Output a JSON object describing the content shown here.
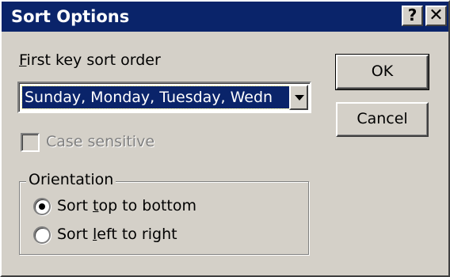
{
  "window": {
    "title": "Sort Options",
    "help_button": "?",
    "close_button": "✕"
  },
  "first_key": {
    "label_prefix": "",
    "label_accel": "F",
    "label_rest": "irst key sort order",
    "selected_value": "Sunday, Monday, Tuesday, Wedn"
  },
  "buttons": {
    "ok": "OK",
    "cancel": "Cancel"
  },
  "case_sensitive": {
    "label": "Case sensitive",
    "checked": false,
    "enabled": false
  },
  "orientation": {
    "legend": "Orientation",
    "options": [
      {
        "pre": "Sort ",
        "accel": "t",
        "post": "op to bottom",
        "checked": true
      },
      {
        "pre": "Sort ",
        "accel": "l",
        "post": "eft to right",
        "checked": false
      }
    ]
  },
  "colors": {
    "face": "#d4d0c8",
    "titlebar": "#0a246a",
    "selection": "#0a246a",
    "disabled_text": "#808080"
  }
}
